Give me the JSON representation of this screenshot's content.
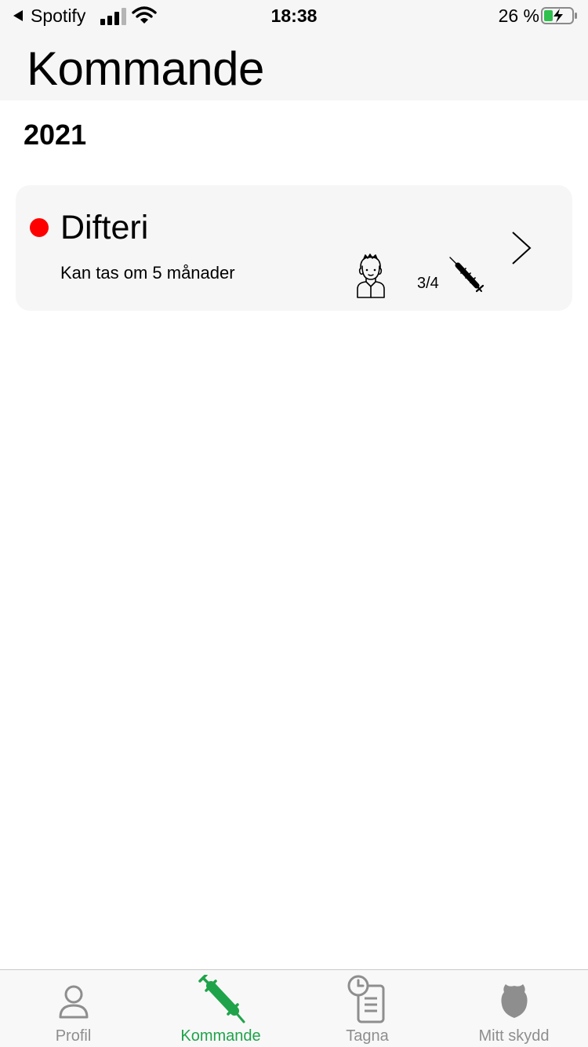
{
  "status_bar": {
    "back_app": "Spotify",
    "time": "18:38",
    "battery": "26 %"
  },
  "header": {
    "title": "Kommande"
  },
  "section": {
    "year": "2021"
  },
  "vaccine_card": {
    "name": "Difteri",
    "subtitle": "Kan tas om 5 månader",
    "dose_count": "3/4",
    "status_color": "#ff0000",
    "person_icon": "person-icon",
    "dose_icon": "syringe-icon"
  },
  "tab_bar": {
    "active_color": "#1fa34a",
    "inactive_color": "#8e8e8e",
    "tabs": [
      {
        "label": "Profil",
        "icon": "profile-icon",
        "active": false
      },
      {
        "label": "Kommande",
        "icon": "syringe-icon",
        "active": true
      },
      {
        "label": "Tagna",
        "icon": "history-document-icon",
        "active": false
      },
      {
        "label": "Mitt skydd",
        "icon": "shield-icon",
        "active": false
      }
    ]
  }
}
